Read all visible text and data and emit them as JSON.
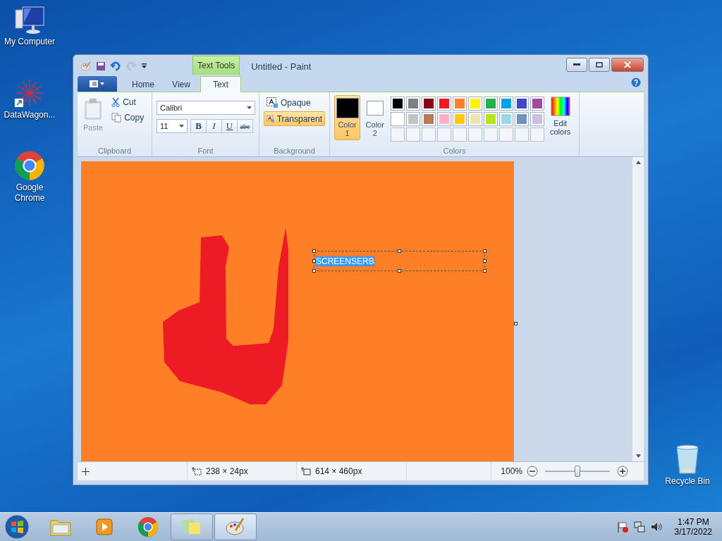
{
  "desktop_icons": [
    {
      "kind": "computer",
      "label": "My Computer"
    },
    {
      "kind": "shortcut",
      "label": "DataWagon..."
    },
    {
      "kind": "chrome",
      "label": "Google Chrome"
    }
  ],
  "recycle_bin": {
    "label": "Recycle Bin"
  },
  "window": {
    "title": "Untitled - Paint",
    "contextual_tab": "Text Tools",
    "tabs": [
      {
        "label": "Home",
        "selected": false
      },
      {
        "label": "View",
        "selected": false
      },
      {
        "label": "Text",
        "selected": true
      }
    ],
    "clipboard": {
      "label": "Clipboard",
      "paste": {
        "label": "Paste",
        "disabled": true
      },
      "cut": "Cut",
      "copy": "Copy"
    },
    "font": {
      "label": "Font",
      "family": "Calibri",
      "size": "11",
      "styles": [
        {
          "kind": "bold",
          "label": "B"
        },
        {
          "kind": "italic",
          "label": "I"
        },
        {
          "kind": "underline",
          "label": "U"
        },
        {
          "kind": "strike",
          "label": "abc"
        }
      ]
    },
    "background": {
      "label": "Background",
      "options": [
        {
          "label": "Opaque",
          "selected": false
        },
        {
          "label": "Transparent",
          "selected": true
        }
      ]
    },
    "colors": {
      "label": "Colors",
      "color1": {
        "label": "Color 1",
        "color": "#000000",
        "selected": true
      },
      "color2": {
        "label": "Color 2",
        "color": "#ffffff",
        "selected": false
      },
      "palette": [
        {
          "color": "#000000"
        },
        {
          "color": "#7f7f7f"
        },
        {
          "color": "#880015"
        },
        {
          "color": "#ed1c24"
        },
        {
          "color": "#ff7f27"
        },
        {
          "color": "#fff200"
        },
        {
          "color": "#22b14c"
        },
        {
          "color": "#00a2e8"
        },
        {
          "color": "#3f48cc"
        },
        {
          "color": "#a349a4"
        },
        {
          "color": "#ffffff"
        },
        {
          "color": "#c3c3c3"
        },
        {
          "color": "#b97a57"
        },
        {
          "color": "#ffaec9"
        },
        {
          "color": "#ffc90e"
        },
        {
          "color": "#efe4b0"
        },
        {
          "color": "#b5e61d"
        },
        {
          "color": "#99d9ea"
        },
        {
          "color": "#7092be"
        },
        {
          "color": "#c8bfe7"
        }
      ],
      "edit_label": "Edit colors"
    },
    "canvas": {
      "text_value": "SCREENSERB"
    },
    "status_bar": {
      "selection_size": "238 × 24px",
      "canvas_size": "614 × 460px",
      "zoom": "100%",
      "zoom_slider": {
        "level": 0.5
      }
    }
  },
  "taskbar": {
    "apps": [
      {
        "kind": "explorer",
        "running": false,
        "selected": false
      },
      {
        "kind": "media",
        "running": false,
        "selected": false
      },
      {
        "kind": "chrome",
        "running": false,
        "selected": false
      },
      {
        "kind": "notes",
        "running": true,
        "selected": false
      },
      {
        "kind": "paint",
        "running": true,
        "selected": true
      }
    ],
    "time": "1:47 PM",
    "date": "3/17/2022"
  }
}
